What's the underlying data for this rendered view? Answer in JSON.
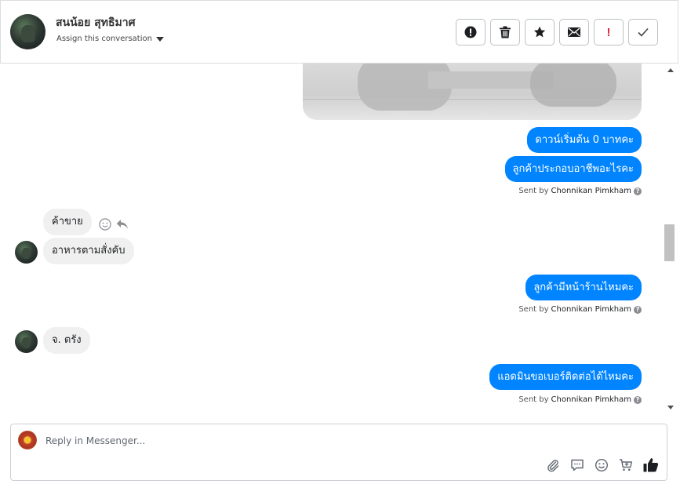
{
  "header": {
    "contact_name": "สนน้อย สุทธิมาศ",
    "assign_label": "Assign this conversation",
    "toolbar": [
      {
        "name": "report-spam-button",
        "icon": "exclamation-circle-icon"
      },
      {
        "name": "delete-button",
        "icon": "trash-icon"
      },
      {
        "name": "star-button",
        "icon": "star-icon"
      },
      {
        "name": "mark-unread-button",
        "icon": "envelope-icon"
      },
      {
        "name": "important-button",
        "icon": "exclamation-icon",
        "label": "!"
      },
      {
        "name": "mark-done-button",
        "icon": "check-icon"
      }
    ]
  },
  "messages": {
    "out_1": "ดาวน์เริ่มต้น 0 บาทคะ",
    "out_2": "ลูกค้าประกอบอาชีพอะไรคะ",
    "sent_by_prefix": "Sent by",
    "sent_by_name": "Chonnikan Pimkham",
    "in_1": "ค้าขาย",
    "in_2": "อาหารตามสั่งคับ",
    "out_3": "ลูกค้ามีหน้าร้านไหมคะ",
    "in_3": "จ. ตรัง",
    "out_4": "แอดมินขอเบอร์ติดต่อได้ไหมคะ",
    "help_glyph": "?"
  },
  "composer": {
    "placeholder": "Reply in Messenger...",
    "tools": [
      "paperclip-icon",
      "saved-reply-icon",
      "emoji-icon",
      "cart-icon",
      "thumbs-up-icon"
    ]
  },
  "colors": {
    "outgoing_bubble": "#0084ff",
    "incoming_bubble": "#f0f0f0",
    "important": "#e41e3f"
  }
}
